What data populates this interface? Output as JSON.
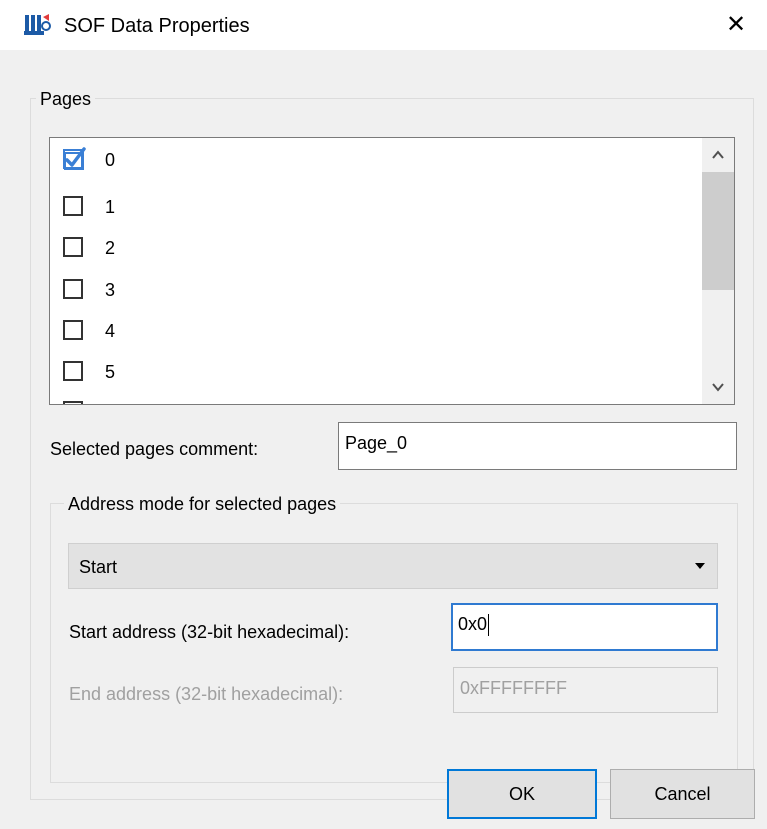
{
  "window": {
    "title": "SOF Data Properties",
    "close_glyph": "✕",
    "app_icon": "quartus-app-icon"
  },
  "pages_group": {
    "legend": "Pages",
    "items": [
      {
        "label": "0",
        "checked": true
      },
      {
        "label": "1",
        "checked": false
      },
      {
        "label": "2",
        "checked": false
      },
      {
        "label": "3",
        "checked": false
      },
      {
        "label": "4",
        "checked": false
      },
      {
        "label": "5",
        "checked": false
      }
    ],
    "scroll_up_glyph": "^",
    "scroll_down_glyph": "v"
  },
  "comment": {
    "label": "Selected pages comment:",
    "value": "Page_0"
  },
  "address_group": {
    "legend": "Address mode for selected pages",
    "mode_value": "Start",
    "start_label": "Start address (32-bit hexadecimal):",
    "start_value": "0x0",
    "end_label": "End address (32-bit hexadecimal):",
    "end_value": "0xFFFFFFFF"
  },
  "buttons": {
    "ok": "OK",
    "cancel": "Cancel"
  },
  "colors": {
    "focus_blue": "#2f7ad1",
    "check_blue": "#3a7fd5",
    "dialog_bg": "#f0f0f0"
  }
}
